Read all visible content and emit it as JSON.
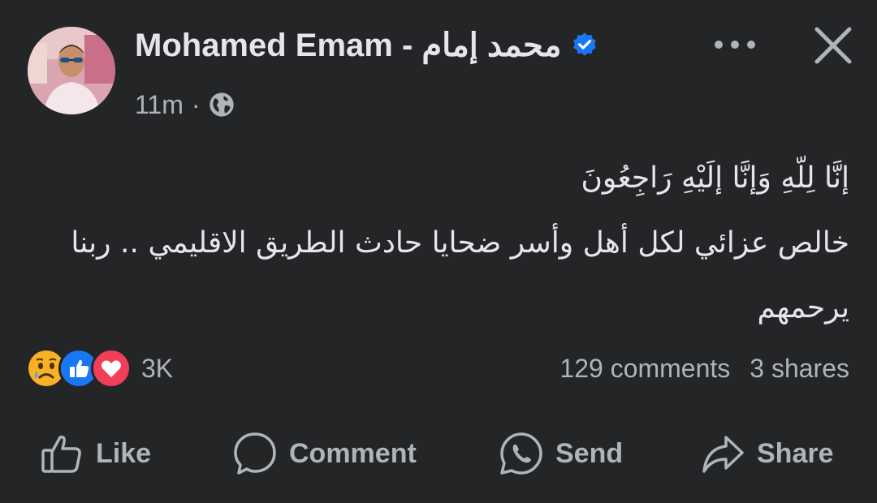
{
  "post": {
    "author_name": "Mohamed Emam - محمد إمام",
    "timestamp": "11m",
    "separator": "·",
    "audience_icon": "globe-icon",
    "text_line1": "إنَّا لِلّهِ وَإنَّا إلَيْهِ رَاجِعُونَ",
    "text_line2": "خالص عزائي لكل أهل وأسر ضحايا حادث الطريق الاقليمي .. ربنا يرحمهم"
  },
  "reactions": {
    "icons": [
      "sad-reaction-icon",
      "like-reaction-icon",
      "love-reaction-icon"
    ],
    "count": "3K"
  },
  "stats": {
    "comments": "129 comments",
    "shares": "3 shares"
  },
  "actions": {
    "like": "Like",
    "comment": "Comment",
    "send": "Send",
    "share": "Share"
  },
  "colors": {
    "background": "#242526",
    "primary_text": "#e4e6eb",
    "secondary_text": "#b0b3b8",
    "verified_blue": "#1877f2",
    "love_red": "#f33e58",
    "sad_yellow": "#f7b125"
  }
}
